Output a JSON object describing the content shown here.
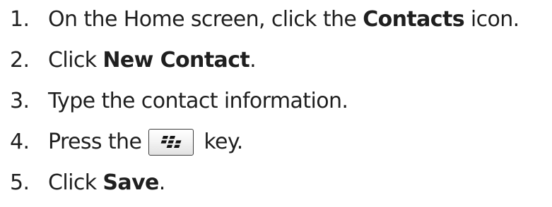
{
  "steps": [
    {
      "number": "1.",
      "before": "On the Home screen, click the ",
      "bold": "Contacts",
      "after": " icon."
    },
    {
      "number": "2.",
      "before": "Click ",
      "bold": "New Contact",
      "after": "."
    },
    {
      "number": "3.",
      "text": "Type the contact information."
    },
    {
      "number": "4.",
      "before": "Press the ",
      "key_icon": "blackberry-menu-key-icon",
      "after": "key."
    },
    {
      "number": "5.",
      "before": "Click ",
      "bold": "Save",
      "after": "."
    }
  ]
}
